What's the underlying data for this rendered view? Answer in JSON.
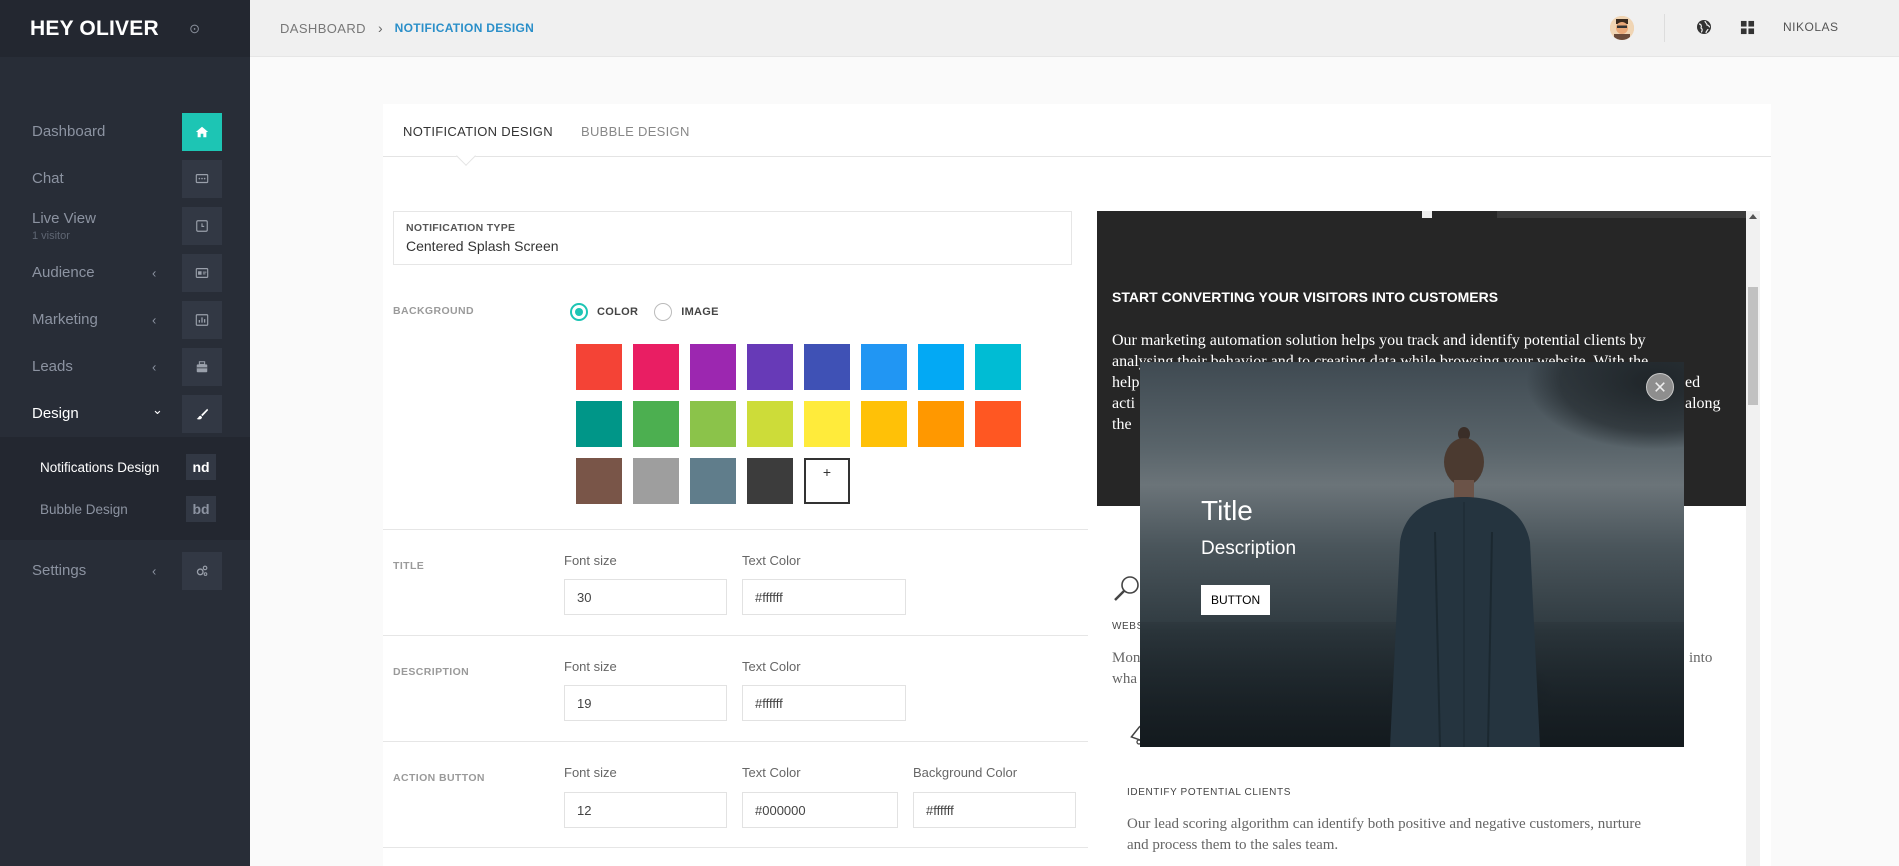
{
  "brand": {
    "name": "HEY OLIVER",
    "dot": "⊙"
  },
  "sidebar": {
    "items": [
      {
        "label": "Dashboard",
        "icon": "home-icon"
      },
      {
        "label": "Chat",
        "icon": "chat-icon"
      },
      {
        "label": "Live View",
        "sub": "1 visitor",
        "icon": "live-view-icon"
      },
      {
        "label": "Audience",
        "icon": "audience-icon",
        "chevron": "‹"
      },
      {
        "label": "Marketing",
        "icon": "chart-icon",
        "chevron": "‹"
      },
      {
        "label": "Leads",
        "icon": "leads-icon",
        "chevron": "‹"
      },
      {
        "label": "Design",
        "icon": "brush-icon",
        "chevron": "⌄"
      }
    ],
    "submenu": [
      {
        "label": "Notifications Design",
        "badge": "nd"
      },
      {
        "label": "Bubble Design",
        "badge": "bd"
      }
    ],
    "settings": {
      "label": "Settings",
      "icon": "settings-icon",
      "chevron": "‹"
    }
  },
  "topbar": {
    "breadcrumb_root": "DASHBOARD",
    "breadcrumb_sep": "›",
    "breadcrumb_current": "NOTIFICATION DESIGN",
    "user": "NIKOLAS"
  },
  "tabs": [
    {
      "label": "NOTIFICATION DESIGN",
      "active": true
    },
    {
      "label": "BUBBLE DESIGN",
      "active": false
    }
  ],
  "form": {
    "type_label": "NOTIFICATION TYPE",
    "type_value": "Centered Splash Screen",
    "background_label": "BACKGROUND",
    "radio_color": "COLOR",
    "radio_image": "IMAGE",
    "add_swatch": "+",
    "swatches": [
      "#f44336",
      "#e91e63",
      "#9c27b0",
      "#673ab7",
      "#3f51b5",
      "#2196f3",
      "#03a9f4",
      "#00bcd4",
      "#009688",
      "#4caf50",
      "#8bc34a",
      "#cddc39",
      "#ffeb3b",
      "#ffc107",
      "#ff9800",
      "#ff5722",
      "#795548",
      "#9e9e9e",
      "#607d8b",
      "#3c3c3c"
    ],
    "title": {
      "label": "TITLE",
      "font_size_label": "Font size",
      "text_color_label": "Text Color",
      "font_size": "30",
      "text_color": "#ffffff"
    },
    "description": {
      "label": "DESCRIPTION",
      "font_size_label": "Font size",
      "text_color_label": "Text Color",
      "font_size": "19",
      "text_color": "#ffffff"
    },
    "action_button": {
      "label": "ACTION BUTTON",
      "font_size_label": "Font size",
      "text_color_label": "Text Color",
      "bg_color_label": "Background Color",
      "font_size": "12",
      "text_color": "#000000",
      "bg_color": "#ffffff"
    }
  },
  "preview": {
    "heading": "START CONVERTING YOUR VISITORS INTO CUSTOMERS",
    "paragraph_lines": [
      "Our marketing automation solution helps you track and identify potential clients by",
      "anal",
      "help",
      "acti",
      "the"
    ],
    "paragraph_right_fragments": [
      "ysing their behavior and to creating data while browsing your website. With the",
      "ed",
      "along"
    ],
    "feature1_title": "WEBS",
    "feature1_text_lines": [
      "Mon",
      "wha"
    ],
    "feature1_text_right": "into",
    "feature2_title": "IDENTIFY POTENTIAL CLIENTS",
    "feature2_text_lines": [
      "Our lead scoring algorithm can identify both positive and negative customers, nurture",
      "and process them to the sales team."
    ]
  },
  "popup": {
    "title": "Title",
    "description": "Description",
    "button": "BUTTON",
    "close": "×"
  },
  "colors": {
    "accent": "#1dc5b4",
    "sidebar": "#282d37",
    "link": "#2a8fc9"
  }
}
